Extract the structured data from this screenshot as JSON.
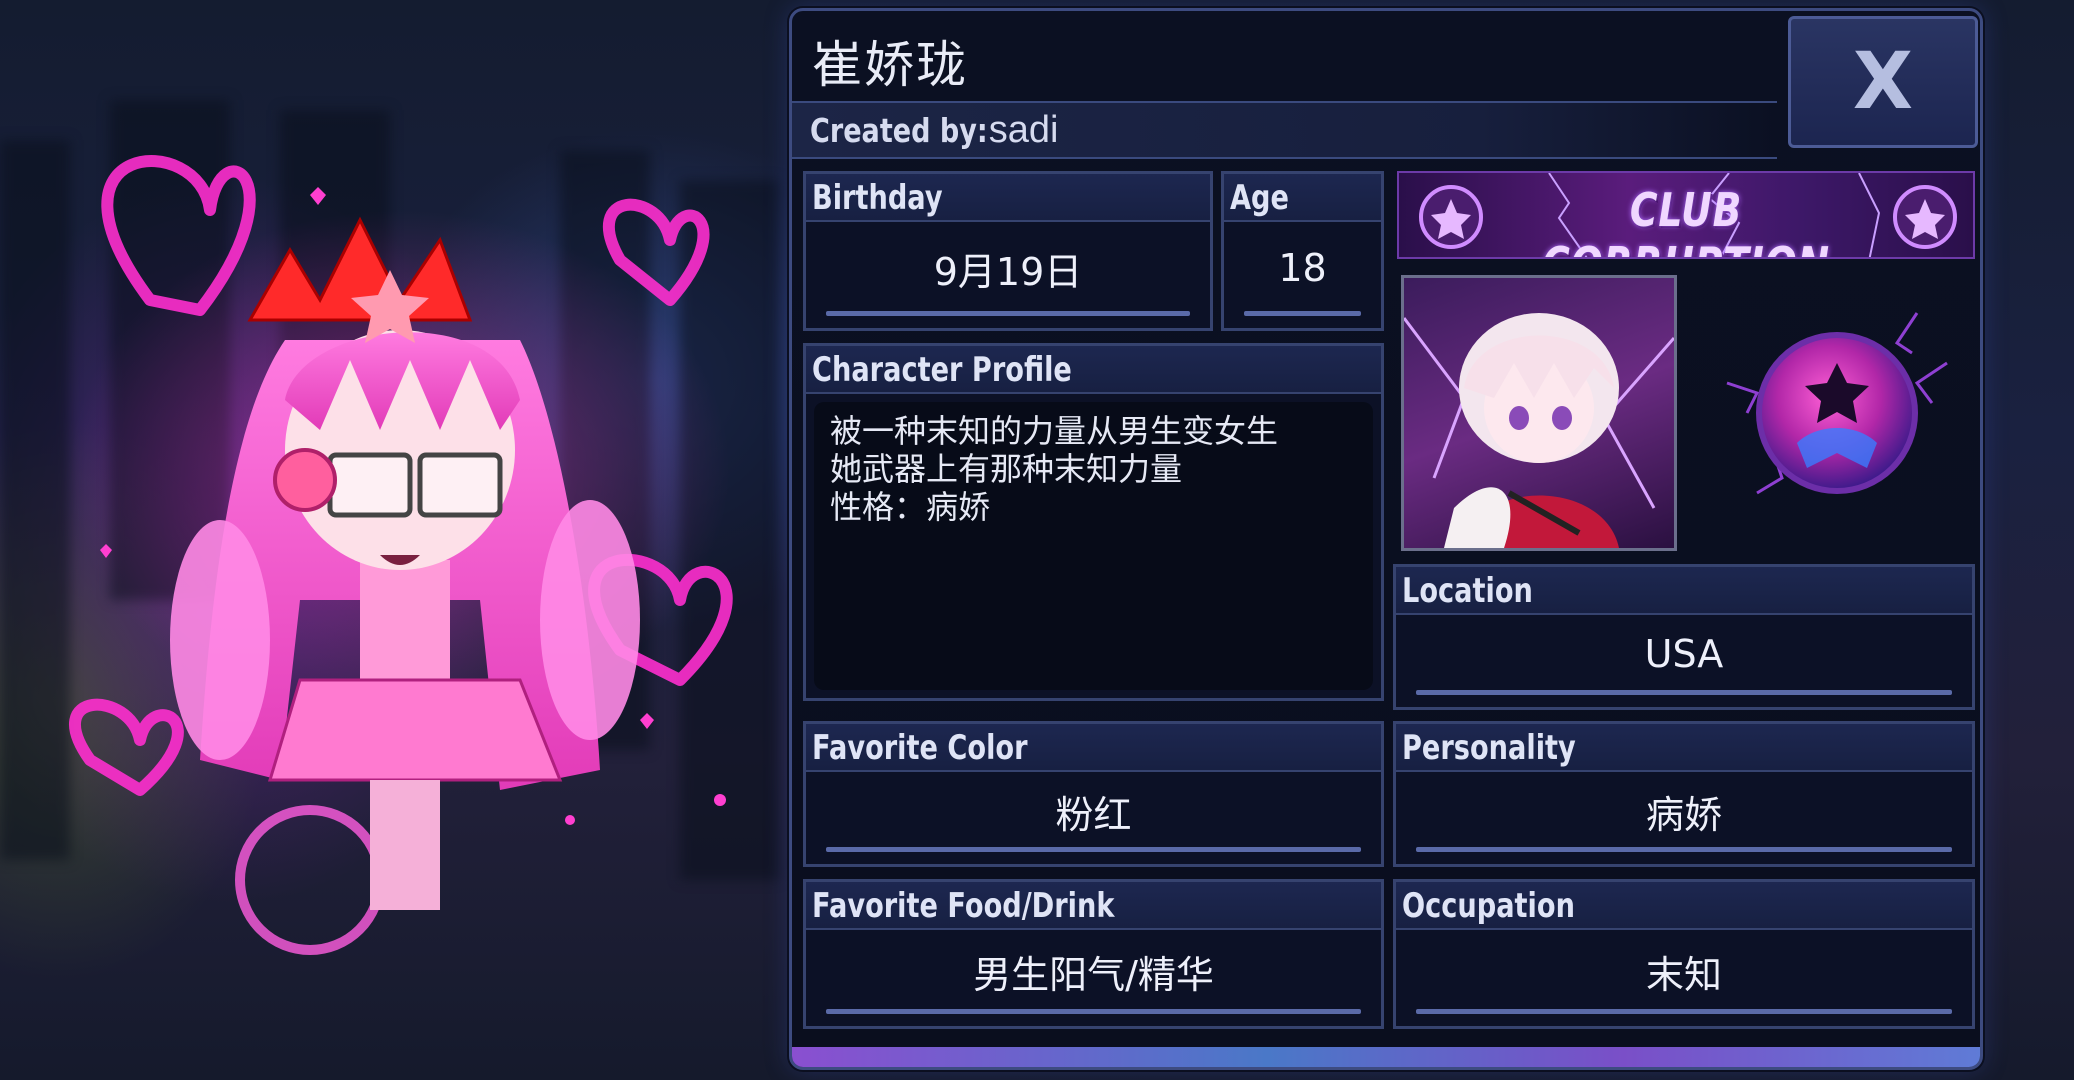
{
  "character": {
    "name": "崔娇珑",
    "creator_label": "Created by:",
    "creator": "sadi"
  },
  "close_button": {
    "label": "X"
  },
  "fields": {
    "birthday": {
      "label": "Birthday",
      "value": "9月19日"
    },
    "age": {
      "label": "Age",
      "value": "18"
    },
    "profile": {
      "label": "Character Profile",
      "lines": [
        "被一种末知的力量从男生变女生",
        "她武器上有那种末知力量",
        "性格：病娇"
      ]
    },
    "location": {
      "label": "Location",
      "value": "USA"
    },
    "favorite_color": {
      "label": "Favorite Color",
      "value": "粉红"
    },
    "personality": {
      "label": "Personality",
      "value": "病娇"
    },
    "favorite_food": {
      "label": "Favorite Food/Drink",
      "value": "男生阳气/精华"
    },
    "occupation": {
      "label": "Occupation",
      "value": "末知"
    }
  },
  "club": {
    "banner_text": "CLUB CORRUPTION",
    "emblem": "corruption-emblem-icon"
  },
  "colors": {
    "panel_bg": "#0b1022",
    "panel_border": "#3d4b80",
    "header_bg": "#1d2750",
    "accent_pink": "#ff3fd0",
    "accent_purple": "#8a4fd0"
  }
}
